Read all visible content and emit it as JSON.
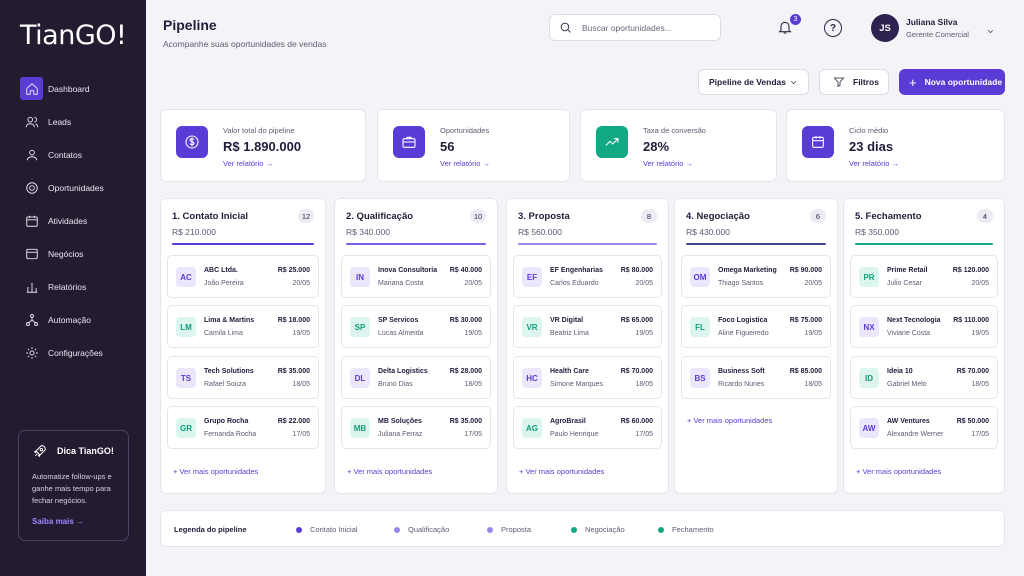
{
  "brand": {
    "logo": "TianGO!"
  },
  "sidebar": {
    "items": [
      {
        "label": "Dashboard",
        "icon": "home-icon",
        "active": true
      },
      {
        "label": "Leads",
        "icon": "users-icon"
      },
      {
        "label": "Contatos",
        "icon": "user-icon"
      },
      {
        "label": "Oportunidades",
        "icon": "target-icon"
      },
      {
        "label": "Atividades",
        "icon": "calendar-icon"
      },
      {
        "label": "Negócios",
        "icon": "briefcase-icon"
      },
      {
        "label": "Relatórios",
        "icon": "bar-chart-icon"
      },
      {
        "label": "Automação",
        "icon": "flow-icon"
      },
      {
        "label": "Configurações",
        "icon": "gear-icon"
      }
    ],
    "tip": {
      "title": "Dica TianGO!",
      "text": "Automatize follow-ups e ganhe mais tempo para fechar negócios.",
      "link": "Saiba mais →"
    }
  },
  "header": {
    "title": "Pipeline",
    "subtitle": "Acompanhe suas oportunidades de vendas",
    "search_placeholder": "Buscar oportunidades...",
    "notifications": "3",
    "help": "?",
    "user": {
      "initials": "JS",
      "name": "Juliana Silva",
      "role": "Gerente Comercial"
    }
  },
  "toolbar": {
    "pipeline_select": "Pipeline de Vendas",
    "filters": "Filtros",
    "new": "Nova oportunidade"
  },
  "kpis": [
    {
      "label": "Valor total do pipeline",
      "value": "R$ 1.890.000",
      "link": "Ver relatório →",
      "icon": "dollar-icon",
      "color": "#5b3bd6"
    },
    {
      "label": "Oportunidades",
      "value": "56",
      "link": "Ver relatório →",
      "icon": "briefcase-icon",
      "color": "#5b3bd6"
    },
    {
      "label": "Taxa de conversão",
      "value": "28%",
      "link": "Ver relatório →",
      "icon": "trend-up-icon",
      "color": "#11a884"
    },
    {
      "label": "Ciclo médio",
      "value": "23 dias",
      "link": "Ver relatório →",
      "icon": "calendar-icon",
      "color": "#5b3bd6"
    }
  ],
  "columns": [
    {
      "title": "1. Contato Inicial",
      "count": "12",
      "total": "R$ 210.000",
      "color": "#5b3bd6",
      "more": "+ Ver mais oportunidades",
      "cards": [
        {
          "initials": "AC",
          "name": "ABC Ltda.",
          "contact": "João Pereira",
          "value": "R$ 25.000",
          "date": "20/05",
          "tone": "purple"
        },
        {
          "initials": "LM",
          "name": "Lima & Martins",
          "contact": "Camila Lima",
          "value": "R$ 18.000",
          "date": "19/05",
          "tone": "green"
        },
        {
          "initials": "TS",
          "name": "Tech Solutions",
          "contact": "Rafael Souza",
          "value": "R$ 35.000",
          "date": "18/05",
          "tone": "purple"
        },
        {
          "initials": "GR",
          "name": "Grupo Rocha",
          "contact": "Fernanda Rocha",
          "value": "R$ 22.000",
          "date": "17/05",
          "tone": "green"
        }
      ]
    },
    {
      "title": "2. Qualificação",
      "count": "10",
      "total": "R$ 340.000",
      "color": "#7b5ce6",
      "more": "+ Ver mais oportunidades",
      "cards": [
        {
          "initials": "IN",
          "name": "Inova Consultoria",
          "contact": "Mariana Costa",
          "value": "R$ 40.000",
          "date": "20/05",
          "tone": "purple"
        },
        {
          "initials": "SP",
          "name": "SP Servicos",
          "contact": "Lucas Almeida",
          "value": "R$ 30.000",
          "date": "19/05",
          "tone": "green"
        },
        {
          "initials": "DL",
          "name": "Delta Logistics",
          "contact": "Bruno Dias",
          "value": "R$ 28.000",
          "date": "18/05",
          "tone": "purple"
        },
        {
          "initials": "MB",
          "name": "MB Soluções",
          "contact": "Juliana Ferraz",
          "value": "R$ 35.000",
          "date": "17/05",
          "tone": "green"
        }
      ]
    },
    {
      "title": "3. Proposta",
      "count": "8",
      "total": "R$ 560.000",
      "color": "#9b85ee",
      "more": "+ Ver mais oportunidades",
      "cards": [
        {
          "initials": "EF",
          "name": "EF Engenharias",
          "contact": "Carlos Eduardo",
          "value": "R$ 80.000",
          "date": "20/05",
          "tone": "purple"
        },
        {
          "initials": "VR",
          "name": "VR Digital",
          "contact": "Beatriz Lima",
          "value": "R$ 65.000",
          "date": "19/05",
          "tone": "green"
        },
        {
          "initials": "HC",
          "name": "Health Care",
          "contact": "Simone Marques",
          "value": "R$ 70.000",
          "date": "18/05",
          "tone": "purple"
        },
        {
          "initials": "AG",
          "name": "AgroBrasil",
          "contact": "Paulo Henrique",
          "value": "R$ 60.000",
          "date": "17/05",
          "tone": "green"
        }
      ]
    },
    {
      "title": "4. Negociação",
      "count": "6",
      "total": "R$ 430.000",
      "color": "#3a4a8c",
      "more": "+ Ver mais oportunidades",
      "cards": [
        {
          "initials": "OM",
          "name": "Omega Marketing",
          "contact": "Thiago Santos",
          "value": "R$ 90.000",
          "date": "20/05",
          "tone": "purple"
        },
        {
          "initials": "FL",
          "name": "Foco Logistica",
          "contact": "Aline Figueiredo",
          "value": "R$ 75.000",
          "date": "19/05",
          "tone": "green"
        },
        {
          "initials": "BS",
          "name": "Business Soft",
          "contact": "Ricardo Nunes",
          "value": "R$ 85.000",
          "date": "18/05",
          "tone": "purple"
        }
      ]
    },
    {
      "title": "5. Fechamento",
      "count": "4",
      "total": "R$ 350.000",
      "color": "#11a884",
      "more": "+ Ver mais oportunidades",
      "cards": [
        {
          "initials": "PR",
          "name": "Prime Retail",
          "contact": "Julio Cesar",
          "value": "R$ 120.000",
          "date": "20/05",
          "tone": "green"
        },
        {
          "initials": "NX",
          "name": "Next Tecnologia",
          "contact": "Viviane Costa",
          "value": "R$ 110.000",
          "date": "19/05",
          "tone": "purple"
        },
        {
          "initials": "ID",
          "name": "Ideia 10",
          "contact": "Gabriel Melo",
          "value": "R$ 70.000",
          "date": "18/05",
          "tone": "green"
        },
        {
          "initials": "AW",
          "name": "AW Ventures",
          "contact": "Alexandre Werner",
          "value": "R$ 50.000",
          "date": "17/05",
          "tone": "purple"
        }
      ]
    }
  ],
  "legend": {
    "title": "Legenda do pipeline",
    "items": [
      {
        "label": "Contato Inicial",
        "color": "#5b3bd6"
      },
      {
        "label": "Qualificação",
        "color": "#9b85ee"
      },
      {
        "label": "Proposta",
        "color": "#9b85ee"
      },
      {
        "label": "Negociação",
        "color": "#11a884"
      },
      {
        "label": "Fechamento",
        "color": "#11a884"
      }
    ]
  }
}
